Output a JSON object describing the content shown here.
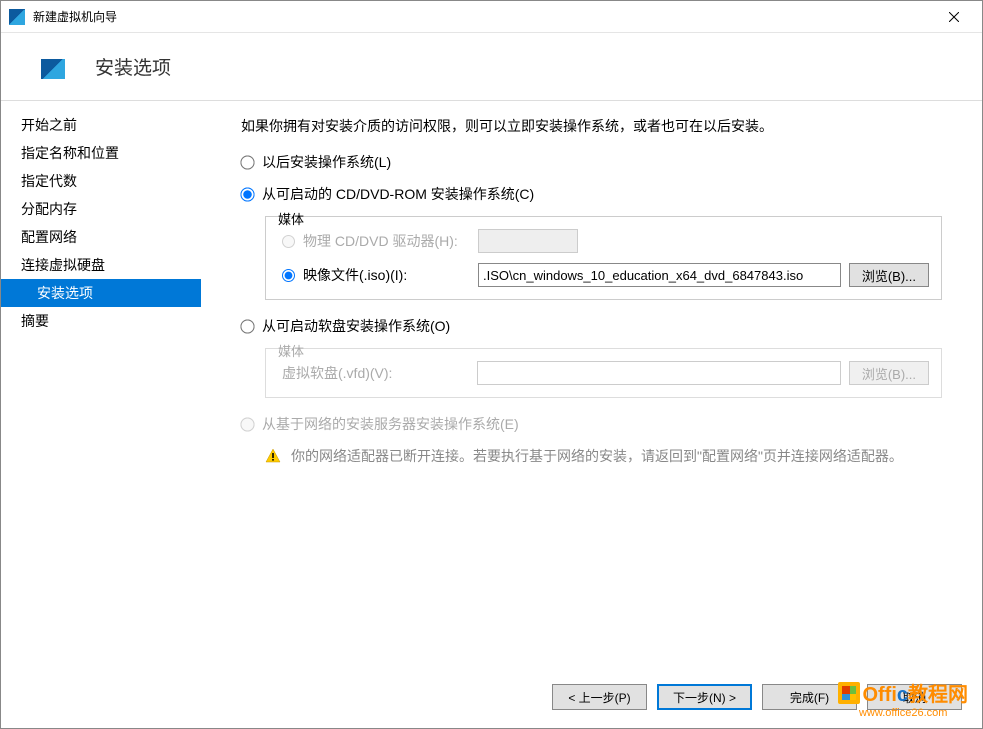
{
  "titlebar": {
    "title": "新建虚拟机向导"
  },
  "header": {
    "title": "安装选项"
  },
  "sidebar": {
    "items": [
      {
        "label": "开始之前"
      },
      {
        "label": "指定名称和位置"
      },
      {
        "label": "指定代数"
      },
      {
        "label": "分配内存"
      },
      {
        "label": "配置网络"
      },
      {
        "label": "连接虚拟硬盘"
      },
      {
        "label": "安装选项"
      },
      {
        "label": "摘要"
      }
    ]
  },
  "main": {
    "intro": "如果你拥有对安装介质的访问权限，则可以立即安装操作系统，或者也可在以后安装。",
    "opt_later": "以后安装操作系统(L)",
    "opt_cd": "从可启动的 CD/DVD-ROM 安装操作系统(C)",
    "cd_fieldset": {
      "legend": "媒体",
      "physical_label": "物理 CD/DVD 驱动器(H):",
      "iso_label": "映像文件(.iso)(I):",
      "iso_value": ".ISO\\cn_windows_10_education_x64_dvd_6847843.iso",
      "browse": "浏览(B)..."
    },
    "opt_floppy": "从可启动软盘安装操作系统(O)",
    "floppy_fieldset": {
      "legend": "媒体",
      "vfd_label": "虚拟软盘(.vfd)(V):",
      "vfd_value": "",
      "browse": "浏览(B)..."
    },
    "opt_network": "从基于网络的安装服务器安装操作系统(E)",
    "network_warning": "你的网络适配器已断开连接。若要执行基于网络的安装，请返回到\"配置网络\"页并连接网络适配器。"
  },
  "footer": {
    "prev": "< 上一步(P)",
    "next": "下一步(N) >",
    "finish": "完成(F)",
    "cancel": "取消"
  },
  "watermark": {
    "brand_prefix": "Offi",
    "brand_mid": "c",
    "brand_suffix": "教程网",
    "url": "www.office26.com"
  }
}
